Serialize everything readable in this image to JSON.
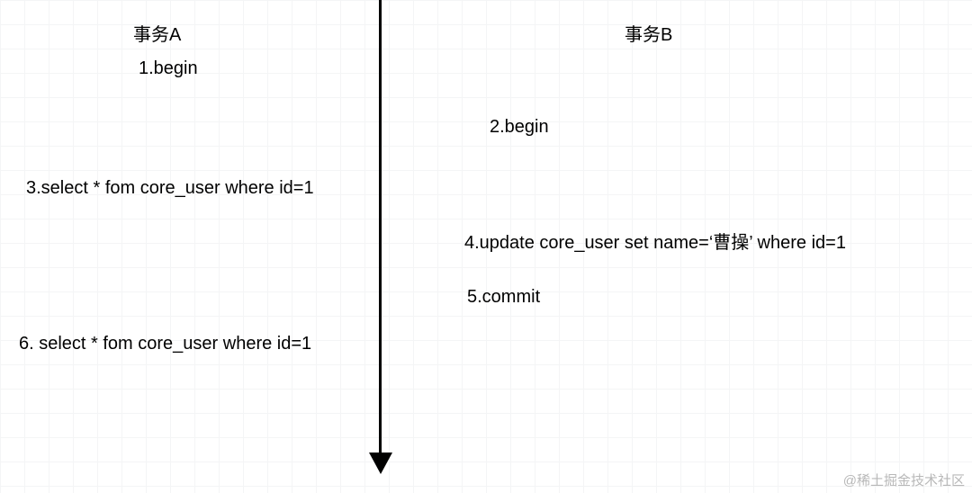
{
  "diagram": {
    "transaction_a": {
      "header": "事务A",
      "steps": {
        "s1": "1.begin",
        "s3": "3.select * fom core_user where id=1",
        "s6": "6. select * fom core_user where id=1"
      }
    },
    "transaction_b": {
      "header": "事务B",
      "steps": {
        "s2": "2.begin",
        "s4": "4.update core_user set name=‘曹操’ where id=1",
        "s5": "5.commit"
      }
    }
  },
  "watermark": "@稀土掘金技术社区"
}
